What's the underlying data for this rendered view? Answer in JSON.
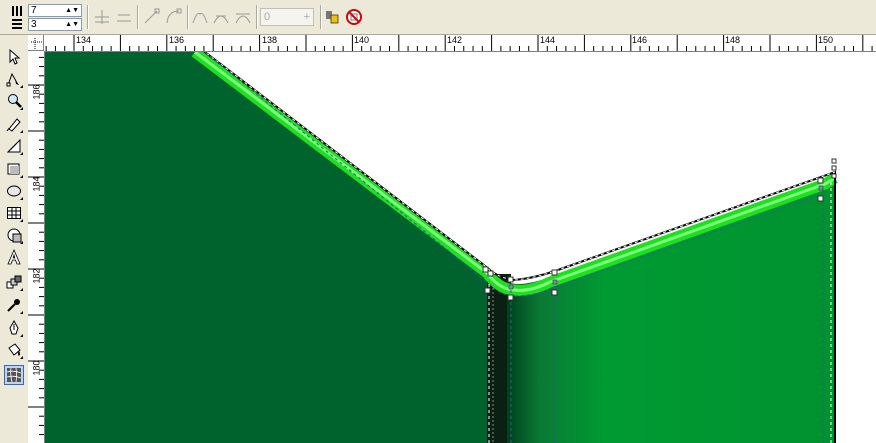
{
  "property_bar": {
    "columns_value": "7",
    "rows_value": "3",
    "node_value": "0",
    "spin_arrows": "▲▼",
    "plus_glyph": "+",
    "icons": [
      "columns-icon",
      "rows-icon",
      "add-node-icon",
      "delete-node-icon",
      "to-line-icon",
      "to-curve-icon",
      "cusp-node-icon",
      "smooth-node-icon",
      "symmetrical-node-icon",
      "reflect-icon",
      "clear-mesh-icon"
    ]
  },
  "toolbox": {
    "tools": [
      "pick-tool-icon",
      "shape-tool-icon",
      "zoom-tool-icon",
      "freehand-tool-icon",
      "smart-fill-icon",
      "rectangle-tool-icon",
      "ellipse-tool-icon",
      "graph-paper-icon",
      "basic-shapes-icon",
      "text-tool-icon",
      "interactive-blend-icon",
      "eyedropper-icon",
      "outline-pen-icon",
      "fill-tool-icon",
      "mesh-fill-tool-icon"
    ],
    "active_tool": "mesh-fill-tool-icon"
  },
  "rulers": {
    "horizontal_labels": [
      "134",
      "136",
      "138",
      "140",
      "142",
      "144",
      "146",
      "148",
      "150"
    ],
    "vertical_labels": [
      "186",
      "184",
      "182",
      "180"
    ]
  },
  "colors": {
    "dark_green": "#00632e",
    "mid_green": "#009630",
    "bright_green": "#1fe01f",
    "ui_bg": "#ece9d8"
  }
}
